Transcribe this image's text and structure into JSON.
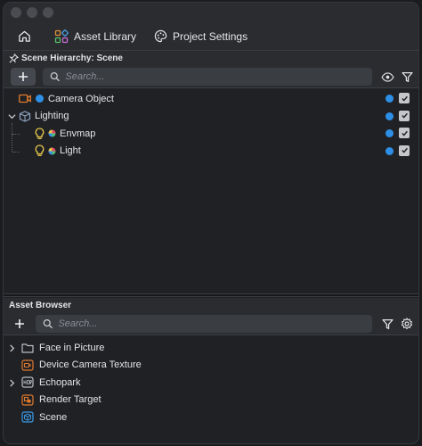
{
  "topnav": {
    "home_icon": "home-icon",
    "asset_library_label": "Asset Library",
    "project_settings_label": "Project Settings"
  },
  "scene_hierarchy": {
    "title": "Scene Hierarchy: Scene",
    "search_placeholder": "Search...",
    "items": [
      {
        "label": "Camera Object",
        "icon": "camera-icon"
      },
      {
        "label": "Lighting",
        "icon": "lighting-group-icon"
      },
      {
        "label": "Envmap",
        "icon": "bulb-icon"
      },
      {
        "label": "Light",
        "icon": "bulb-icon"
      }
    ]
  },
  "asset_browser": {
    "title": "Asset Browser",
    "search_placeholder": "Search...",
    "items": [
      {
        "label": "Face in Picture",
        "icon": "folder-icon"
      },
      {
        "label": "Device Camera Texture",
        "icon": "camera-texture-icon"
      },
      {
        "label": "Echopark",
        "icon": "hdr-icon"
      },
      {
        "label": "Render Target",
        "icon": "render-target-icon"
      },
      {
        "label": "Scene",
        "icon": "scene-icon"
      }
    ]
  },
  "colors": {
    "accent_blue": "#2e8fe6",
    "camera_orange": "#e07a2e",
    "bulb_yellow": "#e8c84a"
  }
}
